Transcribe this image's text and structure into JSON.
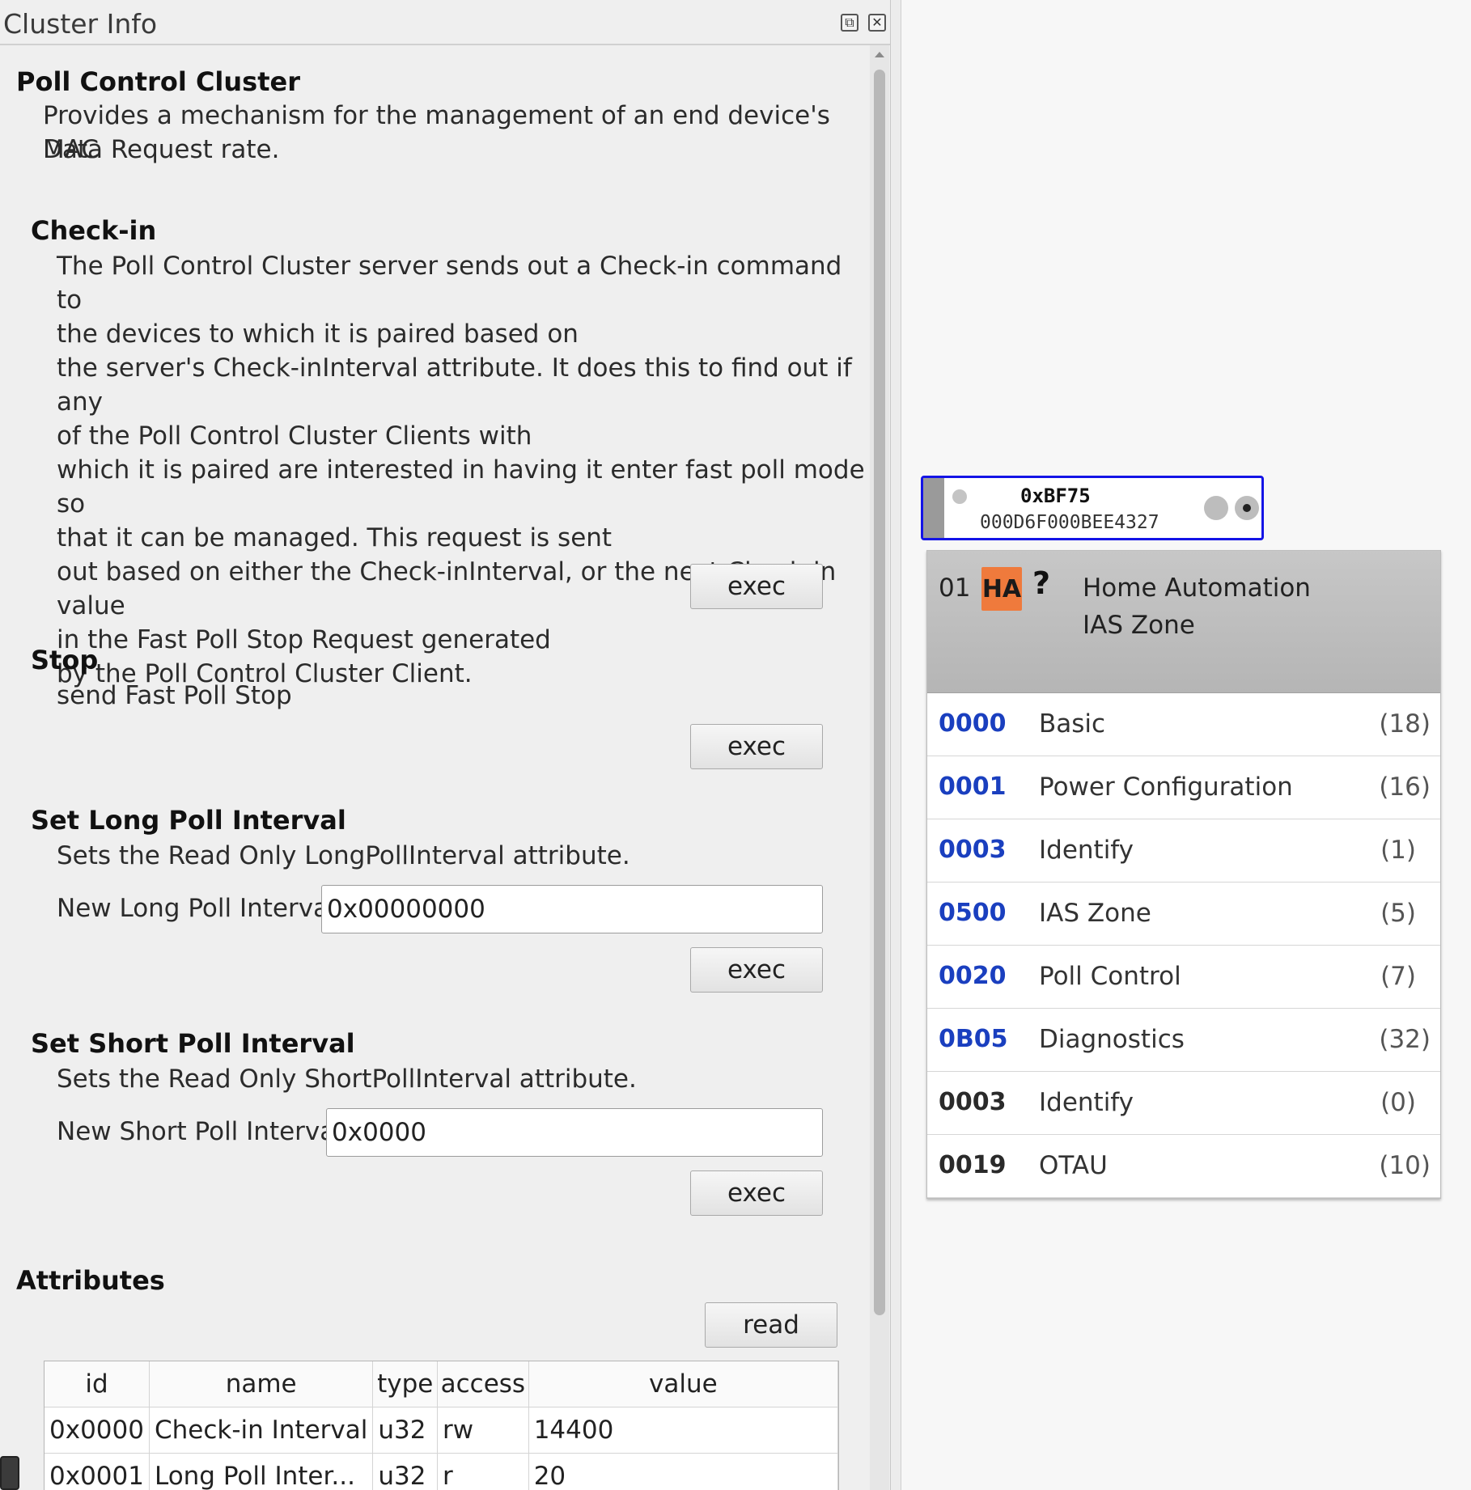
{
  "dock": {
    "title": "Cluster Info",
    "float_icon": "float-window-icon",
    "close_icon": "close-window-icon"
  },
  "cluster": {
    "name": "Poll Control Cluster",
    "description_line1": "Provides a mechanism for the management of an end device's MAC",
    "description_line2": "Data Request rate."
  },
  "commands": {
    "checkin": {
      "title": "Check-in",
      "lines": [
        "The Poll Control Cluster server sends out a Check-in command to",
        "the devices to which it is paired based on",
        "the server's Check-inInterval attribute. It does this to find out if any",
        "of the Poll Control Cluster Clients with",
        "which it is paired are interested in having it enter fast poll mode so",
        "that it can be managed. This request is sent",
        "out based on either the Check-inInterval, or the next Check-in value",
        "in the Fast Poll Stop Request generated",
        "by the Poll Control Cluster Client."
      ],
      "exec_label": "exec"
    },
    "stop": {
      "title": "Stop",
      "description": "send Fast Poll Stop",
      "exec_label": "exec"
    },
    "set_long": {
      "title": "Set Long Poll Interval",
      "description": "Sets the Read Only LongPollInterval attribute.",
      "field_label": "New Long Poll Interval",
      "field_value": "0x00000000",
      "exec_label": "exec"
    },
    "set_short": {
      "title": "Set Short Poll Interval",
      "description": "Sets the Read Only ShortPollInterval attribute.",
      "field_label": "New Short Poll Interval",
      "field_value": "0x0000",
      "exec_label": "exec"
    }
  },
  "attributes": {
    "title": "Attributes",
    "read_label": "read",
    "columns": [
      "id",
      "name",
      "type",
      "access",
      "value"
    ],
    "rows": [
      {
        "id": "0x0000",
        "name": "Check-in Interval",
        "type": "u32",
        "access": "rw",
        "value": "14400"
      },
      {
        "id": "0x0001",
        "name": "Long Poll Inter...",
        "type": "u32",
        "access": "r",
        "value": "20"
      }
    ]
  },
  "node": {
    "nwk_addr": "0xBF75",
    "ext_addr": "000D6F000BEE4327",
    "border_color": "#1414e6"
  },
  "endpoint": {
    "number": "01",
    "profile_badge": "HA",
    "profile_badge_color": "#ef7a3c",
    "unknown_device_icon": "?",
    "profile_name": "Home Automation",
    "device_name": "IAS Zone",
    "clusters": [
      {
        "id": "0000",
        "name": "Basic",
        "count": "(18)",
        "side": "server",
        "id_color": "#1a3fbf"
      },
      {
        "id": "0001",
        "name": "Power Configuration",
        "count": "(16)",
        "side": "server",
        "id_color": "#1a3fbf"
      },
      {
        "id": "0003",
        "name": "Identify",
        "count": "(1)",
        "side": "server",
        "id_color": "#1a3fbf"
      },
      {
        "id": "0500",
        "name": "IAS Zone",
        "count": "(5)",
        "side": "server",
        "id_color": "#1a3fbf"
      },
      {
        "id": "0020",
        "name": "Poll Control",
        "count": "(7)",
        "side": "server",
        "id_color": "#1a3fbf"
      },
      {
        "id": "0B05",
        "name": "Diagnostics",
        "count": "(32)",
        "side": "server",
        "id_color": "#1a3fbf"
      },
      {
        "id": "0003",
        "name": "Identify",
        "count": "(0)",
        "side": "client",
        "id_color": "#2a2a2a"
      },
      {
        "id": "0019",
        "name": "OTAU",
        "count": "(10)",
        "side": "client",
        "id_color": "#2a2a2a"
      }
    ]
  }
}
